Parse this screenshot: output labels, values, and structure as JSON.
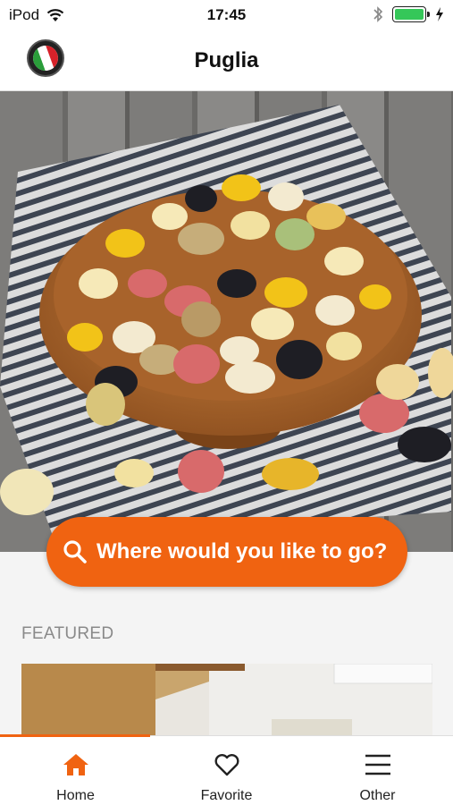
{
  "status_bar": {
    "carrier": "iPod",
    "time": "17:45"
  },
  "nav": {
    "title": "Puglia"
  },
  "search": {
    "label": "Where would you like to go?"
  },
  "featured": {
    "heading": "FEATURED"
  },
  "tabs": [
    {
      "label": "Home",
      "icon": "home-icon",
      "active": true
    },
    {
      "label": "Favorite",
      "icon": "heart-icon",
      "active": false
    },
    {
      "label": "Other",
      "icon": "menu-icon",
      "active": false
    }
  ],
  "colors": {
    "accent": "#f06311",
    "battery": "#35c759"
  }
}
